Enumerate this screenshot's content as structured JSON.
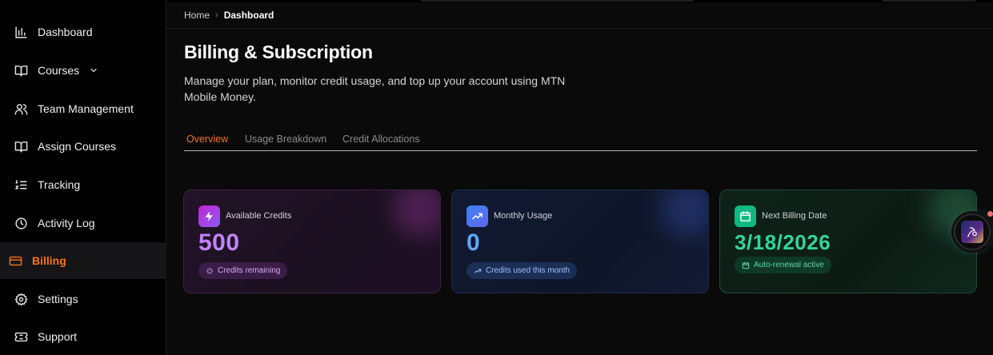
{
  "sidebar": {
    "items": [
      {
        "label": "Dashboard",
        "icon": "bar-chart-icon"
      },
      {
        "label": "Courses",
        "icon": "book-open-icon",
        "has_chevron": true
      },
      {
        "label": "Team Management",
        "icon": "users-icon"
      },
      {
        "label": "Assign Courses",
        "icon": "book-open-icon"
      },
      {
        "label": "Tracking",
        "icon": "list-ordered-icon"
      },
      {
        "label": "Activity Log",
        "icon": "clock-icon"
      },
      {
        "label": "Billing",
        "icon": "credit-card-icon",
        "active": true
      },
      {
        "label": "Settings",
        "icon": "gear-icon"
      },
      {
        "label": "Support",
        "icon": "ticket-icon"
      }
    ]
  },
  "breadcrumb": {
    "home": "Home",
    "separator": "›",
    "current": "Dashboard"
  },
  "page": {
    "title": "Billing & Subscription",
    "description": "Manage your plan, monitor credit usage, and top up your account using MTN Mobile Money."
  },
  "tabs": [
    {
      "label": "Overview",
      "active": true
    },
    {
      "label": "Usage Breakdown",
      "active": false
    },
    {
      "label": "Credit Allocations",
      "active": false
    }
  ],
  "cards": {
    "credits": {
      "title": "Available Credits",
      "value": "500",
      "pill": "Credits remaining",
      "icon": "lightning-icon"
    },
    "usage": {
      "title": "Monthly Usage",
      "value": "0",
      "pill": "Credits used this month",
      "icon": "trending-up-icon"
    },
    "billing": {
      "title": "Next Billing Date",
      "value": "3/18/2026",
      "pill": "Auto-renewal active",
      "icon": "calendar-icon"
    }
  },
  "colors": {
    "accent": "#f97316",
    "purple": "#c084fc",
    "blue": "#60a5fa",
    "green": "#34d399"
  }
}
